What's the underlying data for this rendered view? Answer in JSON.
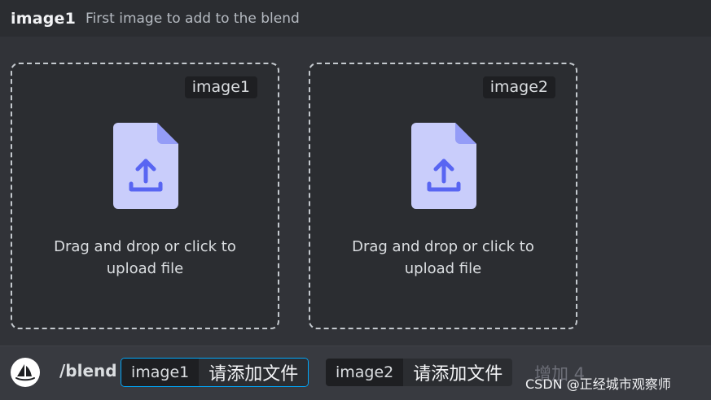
{
  "header": {
    "option_name": "image1",
    "option_description": "First image to add to the blend"
  },
  "dropzones": [
    {
      "tag": "image1",
      "icon": "file-upload-icon",
      "text_line1": "Drag and drop or click to",
      "text_line2": "upload file"
    },
    {
      "tag": "image2",
      "icon": "file-upload-icon",
      "text_line1": "Drag and drop or click to",
      "text_line2": "upload file"
    }
  ],
  "command_bar": {
    "bot_icon": "midjourney-sailboat-icon",
    "command": "/blend",
    "options": [
      {
        "name": "image1",
        "value": "请添加文件"
      },
      {
        "name": "image2",
        "value": "请添加文件"
      }
    ],
    "more_label": "增加 4"
  },
  "watermark": "CSDN @正经城市观察师",
  "colors": {
    "background": "#313338",
    "header_bg": "#2b2d31",
    "accent_border": "#00a8fc",
    "file_icon_fill": "#c9cdfb",
    "file_icon_accent": "#5865f2"
  }
}
